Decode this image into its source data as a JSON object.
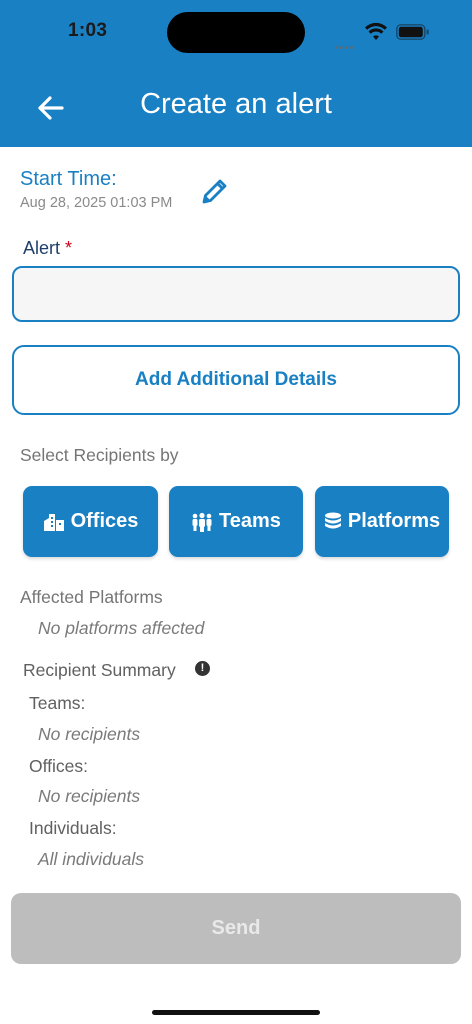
{
  "status_bar": {
    "time": "1:03"
  },
  "header": {
    "title": "Create an alert",
    "back_icon": "arrow-left-icon"
  },
  "start_time": {
    "label": "Start Time:",
    "value": "Aug 28, 2025 01:03 PM",
    "edit_icon": "pencil-icon"
  },
  "alert": {
    "label": "Alert",
    "required_mark": "*",
    "value": "",
    "placeholder": ""
  },
  "details_button": {
    "label": "Add Additional Details"
  },
  "recipients_by": {
    "label": "Select Recipients by",
    "buttons": [
      {
        "label": "Offices",
        "icon": "building-icon"
      },
      {
        "label": "Teams",
        "icon": "people-icon"
      },
      {
        "label": "Platforms",
        "icon": "database-icon"
      }
    ]
  },
  "affected_platforms": {
    "label": "Affected Platforms",
    "value": "No platforms affected"
  },
  "summary": {
    "label": "Recipient Summary",
    "info_icon": "info-icon",
    "teams": {
      "label": "Teams:",
      "value": "No recipients"
    },
    "offices": {
      "label": "Offices:",
      "value": "No recipients"
    },
    "individuals": {
      "label": "Individuals:",
      "value": "All individuals"
    }
  },
  "send_button": {
    "label": "Send",
    "enabled": false
  },
  "colors": {
    "accent": "#1a80c4",
    "disabled": "#bdbdbd",
    "required": "#d0021b"
  }
}
